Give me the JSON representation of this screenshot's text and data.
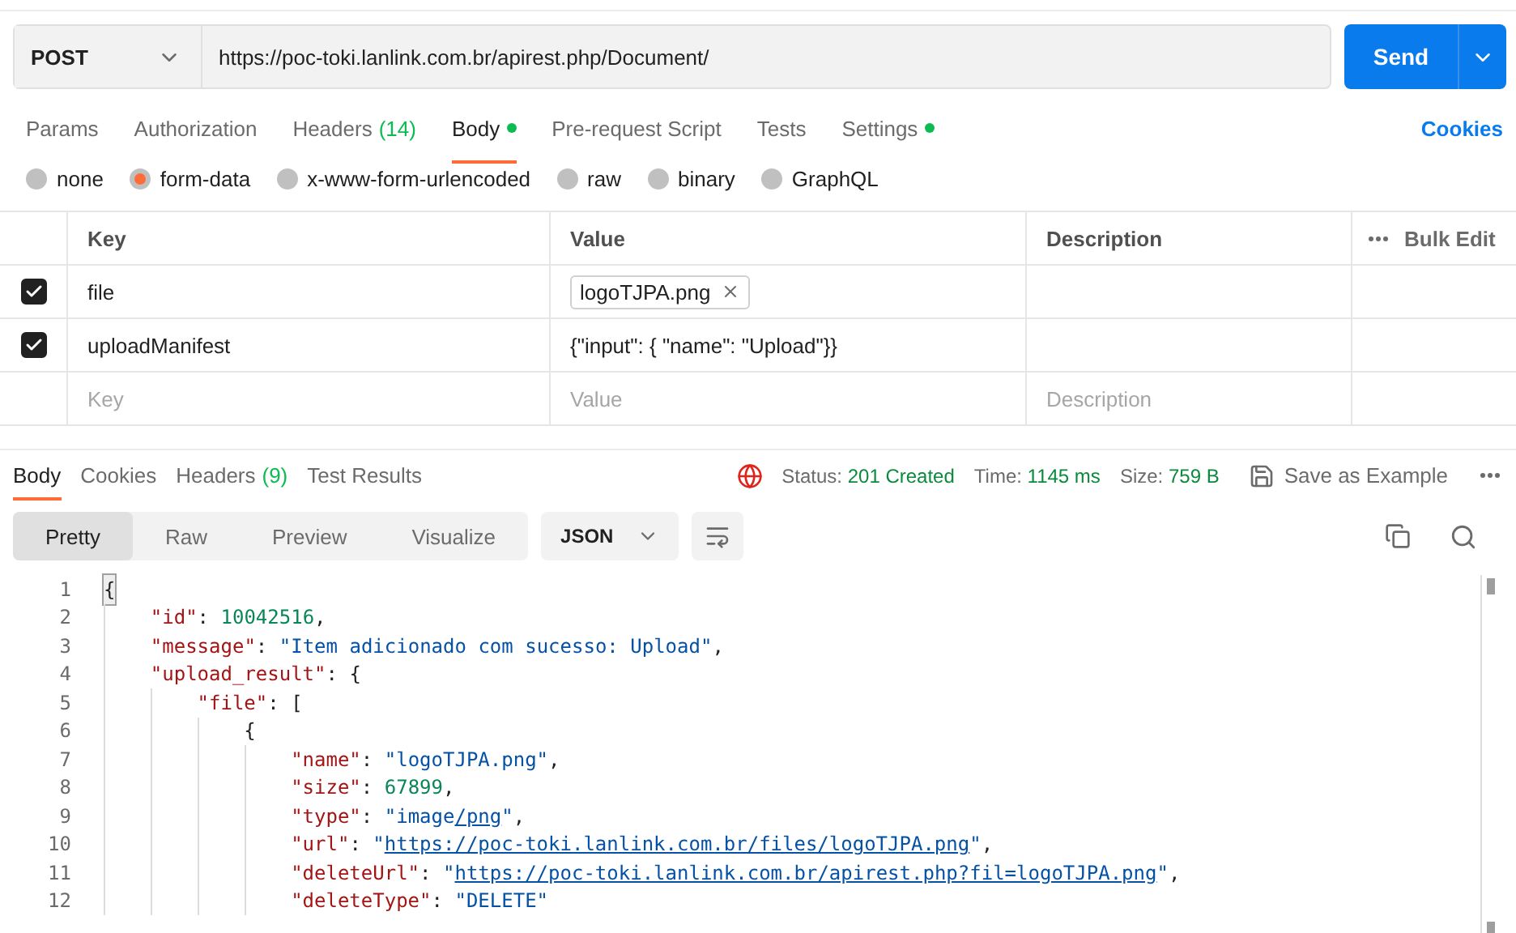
{
  "request": {
    "method": "POST",
    "url": "https://poc-toki.lanlink.com.br/apirest.php/Document/",
    "send_label": "Send"
  },
  "tabs": [
    {
      "label": "Params",
      "selected": false,
      "dot": false
    },
    {
      "label": "Authorization",
      "selected": false,
      "dot": false
    },
    {
      "label": "Headers",
      "count": "(14)",
      "selected": false,
      "dot": false
    },
    {
      "label": "Body",
      "selected": true,
      "dot": true
    },
    {
      "label": "Pre-request Script",
      "selected": false,
      "dot": false
    },
    {
      "label": "Tests",
      "selected": false,
      "dot": false
    },
    {
      "label": "Settings",
      "selected": false,
      "dot": true
    }
  ],
  "cookies_link": "Cookies",
  "body_types": [
    {
      "label": "none",
      "selected": false
    },
    {
      "label": "form-data",
      "selected": true
    },
    {
      "label": "x-www-form-urlencoded",
      "selected": false
    },
    {
      "label": "raw",
      "selected": false
    },
    {
      "label": "binary",
      "selected": false
    },
    {
      "label": "GraphQL",
      "selected": false
    }
  ],
  "params_table": {
    "columns": [
      "Key",
      "Value",
      "Description"
    ],
    "bulk_edit": "Bulk Edit",
    "rows": [
      {
        "checked": true,
        "key": "file",
        "value": "logoTJPA.png",
        "kind": "file"
      },
      {
        "checked": true,
        "key": "uploadManifest",
        "value": "{\"input\": { \"name\": \"Upload\"}}",
        "kind": "text"
      }
    ],
    "empty_row": [
      {
        "placeholder": "Key"
      },
      {
        "placeholder": "Value"
      },
      {
        "placeholder": "Description"
      }
    ]
  },
  "response": {
    "tabs": [
      {
        "label": "Body",
        "selected": true
      },
      {
        "label": "Cookies",
        "selected": false
      },
      {
        "label": "Headers",
        "count": "(9)",
        "selected": false
      },
      {
        "label": "Test Results",
        "selected": false
      }
    ],
    "status": {
      "label": "Status:",
      "value": "201 Created"
    },
    "time": {
      "label": "Time:",
      "value": "1145 ms"
    },
    "size": {
      "label": "Size:",
      "value": "759 B"
    },
    "save_label": "Save as Example",
    "view_modes": [
      {
        "label": "Pretty",
        "selected": true
      },
      {
        "label": "Raw",
        "selected": false
      },
      {
        "label": "Preview",
        "selected": false
      },
      {
        "label": "Visualize",
        "selected": false
      }
    ],
    "format": "JSON",
    "lines": [
      {
        "n": "1",
        "tokens": [
          {
            "kind": "cursor",
            "text": "{"
          }
        ],
        "children": [
          {
            "n": "2",
            "tokens": [
              {
                "kind": "key",
                "text": "\"id\""
              },
              {
                "kind": "punct",
                "text": ": "
              },
              {
                "kind": "number",
                "text": "10042516"
              },
              {
                "kind": "punct",
                "text": ","
              }
            ]
          },
          {
            "n": "3",
            "tokens": [
              {
                "kind": "key",
                "text": "\"message\""
              },
              {
                "kind": "punct",
                "text": ": "
              },
              {
                "kind": "string",
                "text": "\"Item adicionado com sucesso: Upload\""
              },
              {
                "kind": "punct",
                "text": ","
              }
            ]
          },
          {
            "n": "4",
            "tokens": [
              {
                "kind": "key",
                "text": "\"upload_result\""
              },
              {
                "kind": "punct",
                "text": ": {"
              }
            ],
            "children": [
              {
                "n": "5",
                "tokens": [
                  {
                    "kind": "key",
                    "text": "\"file\""
                  },
                  {
                    "kind": "punct",
                    "text": ": ["
                  }
                ],
                "children": [
                  {
                    "n": "6",
                    "tokens": [
                      {
                        "kind": "punct",
                        "text": "{"
                      }
                    ],
                    "children": [
                      {
                        "n": "7",
                        "tokens": [
                          {
                            "kind": "key",
                            "text": "\"name\""
                          },
                          {
                            "kind": "punct",
                            "text": ": "
                          },
                          {
                            "kind": "string",
                            "text": "\"logoTJPA.png\""
                          },
                          {
                            "kind": "punct",
                            "text": ","
                          }
                        ]
                      },
                      {
                        "n": "8",
                        "tokens": [
                          {
                            "kind": "key",
                            "text": "\"size\""
                          },
                          {
                            "kind": "punct",
                            "text": ": "
                          },
                          {
                            "kind": "number",
                            "text": "67899"
                          },
                          {
                            "kind": "punct",
                            "text": ","
                          }
                        ]
                      },
                      {
                        "n": "9",
                        "tokens": [
                          {
                            "kind": "key",
                            "text": "\"type\""
                          },
                          {
                            "kind": "punct",
                            "text": ": "
                          },
                          {
                            "kind": "string",
                            "text": "\"image"
                          },
                          {
                            "kind": "link",
                            "text": "/png"
                          },
                          {
                            "kind": "string",
                            "text": "\""
                          },
                          {
                            "kind": "punct",
                            "text": ","
                          }
                        ]
                      },
                      {
                        "n": "10",
                        "tokens": [
                          {
                            "kind": "key",
                            "text": "\"url\""
                          },
                          {
                            "kind": "punct",
                            "text": ": "
                          },
                          {
                            "kind": "string",
                            "text": "\""
                          },
                          {
                            "kind": "link",
                            "text": "https://poc-toki.lanlink.com.br/files/logoTJPA.png"
                          },
                          {
                            "kind": "string",
                            "text": "\""
                          },
                          {
                            "kind": "punct",
                            "text": ","
                          }
                        ]
                      },
                      {
                        "n": "11",
                        "tokens": [
                          {
                            "kind": "key",
                            "text": "\"deleteUrl\""
                          },
                          {
                            "kind": "punct",
                            "text": ": "
                          },
                          {
                            "kind": "string",
                            "text": "\""
                          },
                          {
                            "kind": "link",
                            "text": "https://poc-toki.lanlink.com.br/apirest.php?fil=logoTJPA.png"
                          },
                          {
                            "kind": "string",
                            "text": "\""
                          },
                          {
                            "kind": "punct",
                            "text": ","
                          }
                        ]
                      },
                      {
                        "n": "12",
                        "tokens": [
                          {
                            "kind": "key",
                            "text": "\"deleteType\""
                          },
                          {
                            "kind": "punct",
                            "text": ": "
                          },
                          {
                            "kind": "string",
                            "text": "\"DELETE\""
                          }
                        ]
                      }
                    ]
                  }
                ]
              }
            ]
          }
        ]
      }
    ]
  }
}
